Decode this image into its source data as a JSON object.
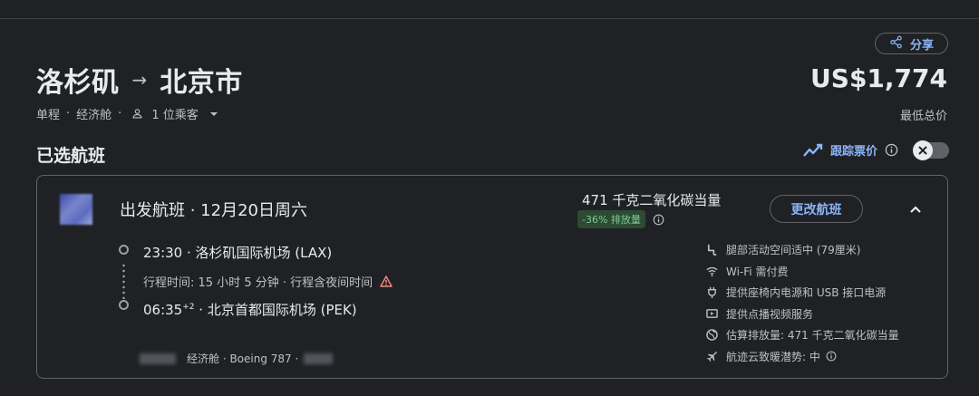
{
  "header": {
    "share_label": "分享",
    "origin": "洛杉矶",
    "destination": "北京市",
    "arrow": "→",
    "trip_type": "单程",
    "cabin": "经济舱",
    "passengers": "1 位乘客",
    "price": "US$1,774",
    "price_note": "最低总价"
  },
  "section": {
    "title": "已选航班",
    "track_label": "跟踪票价"
  },
  "flight": {
    "title": "出发航班 · 12月20日周六",
    "co2": "471 千克二氧化碳当量",
    "emission_badge": "-36% 排放量",
    "change_label": "更改航班",
    "departure": "23:30 · 洛杉矶国际机场 (LAX)",
    "duration": "行程时间: 15 小时 5 分钟 · 行程含夜间时间",
    "arrival_time": "06:35",
    "arrival_offset": "+2",
    "arrival_airport": " · 北京首都国际机场 (PEK)",
    "details": "经济舱 · Boeing 787 ·"
  },
  "amenities": [
    {
      "icon": "legroom-icon",
      "label": "腿部活动空间适中 (79厘米)"
    },
    {
      "icon": "wifi-icon",
      "label": "Wi-Fi 需付费"
    },
    {
      "icon": "power-plug-icon",
      "label": "提供座椅内电源和 USB 接口电源"
    },
    {
      "icon": "video-icon",
      "label": "提供点播视频服务"
    },
    {
      "icon": "globe-icon",
      "label": "估算排放量: 471 千克二氧化碳当量"
    },
    {
      "icon": "contrail-icon",
      "label": "航迹云致暖潜势: 中"
    }
  ],
  "colors": {
    "accent": "#8ab4f8",
    "background": "#202124",
    "badge_bg": "#2d4a33",
    "badge_fg": "#81c995",
    "warning": "#f28b82"
  }
}
